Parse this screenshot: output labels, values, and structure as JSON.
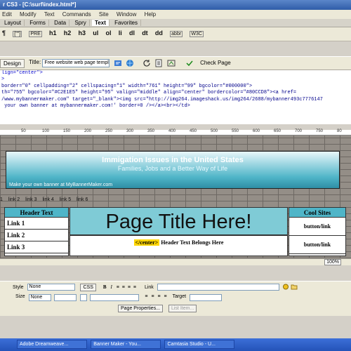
{
  "window": {
    "title": "r CS3 - [C:\\surf\\index.html*]"
  },
  "menubar": [
    "Edit",
    "Modify",
    "Text",
    "Commands",
    "Site",
    "Window",
    "Help"
  ],
  "insert_tabs": [
    "Layout",
    "Forms",
    "Data",
    "Spry",
    "Text",
    "Favorites"
  ],
  "insert_active_tab": "Text",
  "insert_buttons": [
    "¶",
    "[\"\"]",
    "PRE",
    "h1",
    "h2",
    "h3",
    "ul",
    "ol",
    "li",
    "dl",
    "dt",
    "dd",
    "abbr",
    "W3C"
  ],
  "doc_toolbar": {
    "design_label": "Design",
    "title_label": "Title:",
    "title_value": "Free website web page templa",
    "check_page_label": "Check Page"
  },
  "code_lines": [
    "lign=\"center\">",
    ">",
    "border=\"0\" cellpadding=\"2\" cellspacing=\"1\" width=\"761\" height=\"99\" bgcolor=\"#000000\">",
    "",
    "th=\"755\" bgcolor=\"#C2E1E5\" height=\"95\" valign=\"middle\" align=\"center\" bordercolor=\"#80CCD8\"><a href=",
    "/www.mybannermaker.com\" target=\"_blank\"><img src=\"http://img264.imageshack.us/img264/2688/mybanner493c7776147",
    " your own banner at mybannermaker.com!' border=0 /></a><br></td>"
  ],
  "ruler_ticks": [
    "50",
    "100",
    "150",
    "200",
    "250",
    "300",
    "350",
    "400",
    "450",
    "500",
    "550",
    "600",
    "650",
    "700",
    "750",
    "80"
  ],
  "banner": {
    "title": "Immigation Issues in the United States",
    "subtitle": "Families, Jobs and a Better Way of Life",
    "credit": "Make your own banner at MyBannerMaker.com"
  },
  "link_row": [
    "1",
    "link 2",
    "link 3",
    "link 4",
    "link 5",
    "link 6"
  ],
  "left_column": {
    "header": "Header Text",
    "links": [
      "Link 1",
      "Link 2",
      "Link 3"
    ]
  },
  "center": {
    "page_title": "Page Title Here!",
    "tag_marker": "</center>",
    "header_text": "Header Text Belongs Here"
  },
  "right_column": {
    "header": "Cool Sites",
    "links": [
      "button/link",
      "button/link"
    ]
  },
  "status": {
    "zoom": "100%"
  },
  "properties": {
    "style_label": "Style",
    "style_value": "None",
    "css_label": "CSS",
    "size_label": "Size",
    "size_value": "None",
    "link_label": "Link",
    "target_label": "Target",
    "page_properties_label": "Page Properties...",
    "list_item_label": "List Item..."
  },
  "taskbar": [
    "Adobe Dreamweave...",
    "Banner Maker - You...",
    "Camtasia Studio - U..."
  ]
}
